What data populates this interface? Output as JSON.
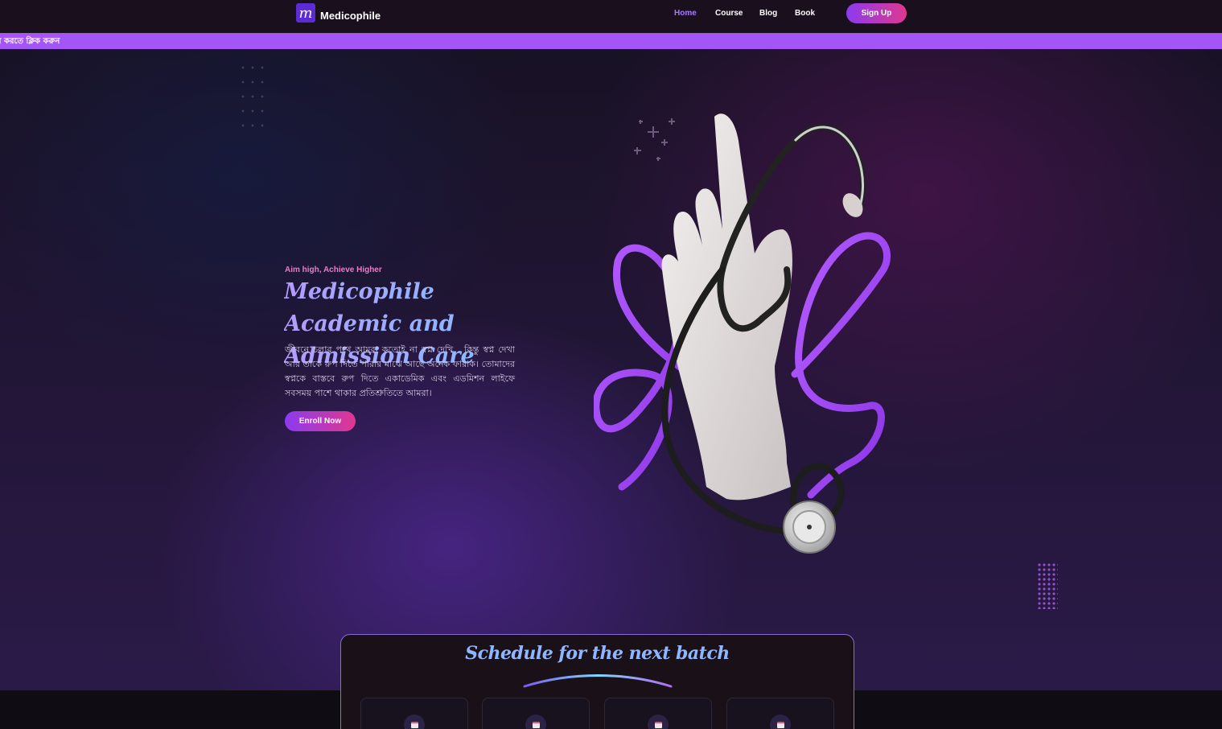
{
  "nav": {
    "brand": "Medicophile",
    "links": [
      {
        "label": "Home",
        "active": true
      },
      {
        "label": "Course",
        "active": false
      },
      {
        "label": "Blog",
        "active": false
      },
      {
        "label": "Book",
        "active": false
      }
    ],
    "signup_label": "Sign Up"
  },
  "marquee": {
    "text": "র করতে ক্লিক করুন"
  },
  "hero": {
    "eyebrow": "Aim high, Achieve Higher",
    "title": "Medicophile Academic and Admission Care",
    "description": "জীবনে চলার পথে আমরা কতোই না স্বপ্ন দেখি , কিন্তু স্বপ্ন দেখা আর তাকে রুপ দিতে পারার মাঝে আছে অনেক ফারাক। তোমাদের স্বপ্নকে বাস্তবে রুপ দিতে একাডেমিক এবং এডমিশন লাইফে সবসময় পাশে থাকার প্রতিশ্রুতিতে আমরা।",
    "enroll_label": "Enroll Now",
    "image_icon": "gloved-hand-stethoscope-illustration"
  },
  "schedule": {
    "title": "Schedule for the next batch",
    "card_icon": "calendar-icon"
  },
  "colors": {
    "accent_purple": "#a356f5",
    "gradient_start": "#8b3bf0",
    "gradient_end": "#e0378f",
    "nav_active": "#a77bff",
    "title_blue": "#8fb0ff"
  }
}
